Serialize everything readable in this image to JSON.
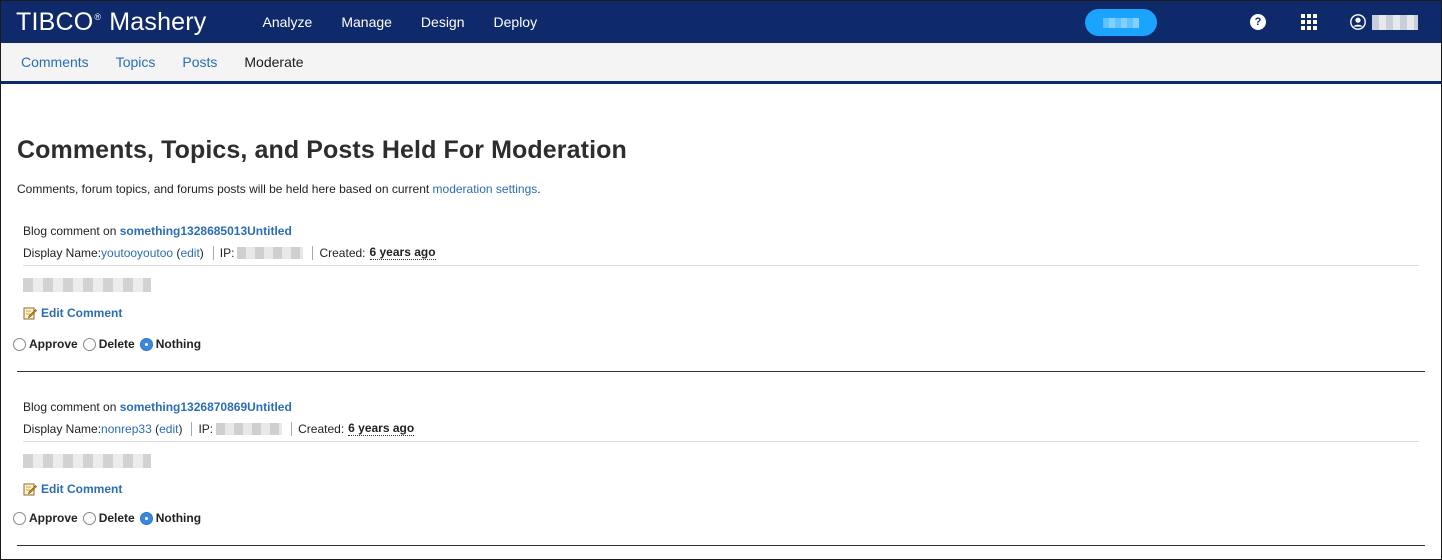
{
  "header": {
    "brand_tibco": "TIBCO",
    "brand_reg": "®",
    "brand_mashery": "Mashery",
    "nav": [
      "Analyze",
      "Manage",
      "Design",
      "Deploy"
    ],
    "help_glyph": "?"
  },
  "subnav": {
    "tabs": [
      "Comments",
      "Topics",
      "Posts",
      "Moderate"
    ],
    "active": "Moderate"
  },
  "page": {
    "title": "Comments, Topics, and Posts Held For Moderation",
    "intro_text": "Comments, forum topics, and forums posts will be held here based on current ",
    "intro_link": "moderation settings",
    "intro_end": "."
  },
  "labels": {
    "blog_comment_on": "Blog comment on ",
    "display_name": "Display Name: ",
    "edit": "edit",
    "ip": "IP:",
    "created": "Created:",
    "edit_comment": "Edit Comment",
    "approve": "Approve",
    "delete": "Delete",
    "nothing": "Nothing"
  },
  "items": [
    {
      "post": "something1328685013Untitled",
      "display_name": "youtooyoutoo",
      "created": "6 years ago",
      "selected": "Nothing"
    },
    {
      "post": "something1326870869Untitled",
      "display_name": "nonrep33",
      "created": "6 years ago",
      "selected": "Nothing"
    }
  ],
  "colors": {
    "topbar": "#0f2a6b",
    "link": "#2a6db6",
    "pill": "#1aa3ff"
  }
}
